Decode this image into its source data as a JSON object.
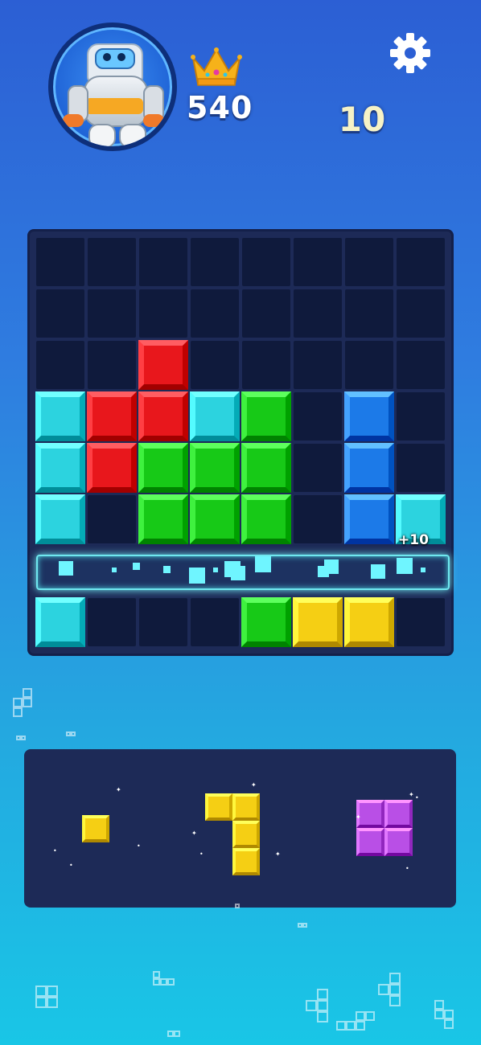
{
  "header": {
    "best_score": "540",
    "current_score": "10",
    "avatar_icon": "robot-avatar-icon",
    "crown_icon": "crown-icon",
    "settings_icon": "gear-icon"
  },
  "board": {
    "rows": 8,
    "cols": 8,
    "grid": [
      [
        "",
        "",
        "",
        "",
        "",
        "",
        "",
        ""
      ],
      [
        "",
        "",
        "",
        "",
        "",
        "",
        "",
        ""
      ],
      [
        "",
        "",
        "red",
        "",
        "",
        "",
        "",
        ""
      ],
      [
        "cyan",
        "red",
        "red",
        "cyan",
        "green",
        "",
        "blue",
        ""
      ],
      [
        "cyan",
        "red",
        "green",
        "green",
        "green",
        "",
        "blue",
        ""
      ],
      [
        "cyan",
        "",
        "green",
        "green",
        "green",
        "",
        "blue",
        "cyan"
      ],
      [
        "",
        "",
        "",
        "",
        "",
        "",
        "",
        ""
      ],
      [
        "cyan",
        "",
        "",
        "",
        "green",
        "yellow",
        "yellow",
        ""
      ]
    ],
    "clearing_row": 6,
    "points_popup": "+10"
  },
  "tray": {
    "pieces": [
      {
        "name": "single-square",
        "color": "yellow",
        "cells": [
          [
            0,
            0
          ]
        ]
      },
      {
        "name": "j-piece",
        "color": "yellow",
        "cells": [
          [
            0,
            0
          ],
          [
            0,
            1
          ],
          [
            1,
            1
          ],
          [
            2,
            1
          ]
        ]
      },
      {
        "name": "square-2x2",
        "color": "purple",
        "cells": [
          [
            0,
            0
          ],
          [
            0,
            1
          ],
          [
            1,
            0
          ],
          [
            1,
            1
          ]
        ]
      }
    ]
  },
  "colors": {
    "red": "#e8171c",
    "cyan": "#2cd3df",
    "green": "#17c917",
    "blue": "#1c7ae8",
    "yellow": "#f5cf14",
    "purple": "#b94fe6"
  }
}
